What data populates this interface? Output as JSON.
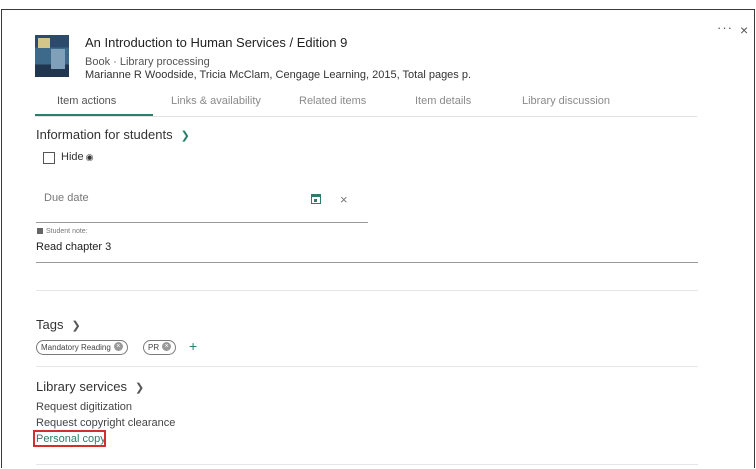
{
  "window": {
    "more_label": "···",
    "close_label": "×"
  },
  "item": {
    "title": "An Introduction to Human Services / Edition 9",
    "meta_line": "Book · Library processing",
    "authors_line": "Marianne R Woodside, Tricia McClam, Cengage Learning, 2015, Total pages p."
  },
  "tabs": [
    {
      "label": "Item actions",
      "active": true
    },
    {
      "label": "Links & availability",
      "active": false
    },
    {
      "label": "Related items",
      "active": false
    },
    {
      "label": "Item details",
      "active": false
    },
    {
      "label": "Library discussion",
      "active": false
    }
  ],
  "students": {
    "heading": "Information for students",
    "hide_label": "Hide",
    "hide_checked": false,
    "due_date_placeholder": "Due date",
    "clear_label": "×",
    "note_label": "Student note:",
    "note_value": "Read chapter 3"
  },
  "tags": {
    "heading": "Tags",
    "items": [
      {
        "label": "Mandatory Reading"
      },
      {
        "label": "PR"
      }
    ],
    "add_label": "+"
  },
  "library_services": {
    "heading": "Library services",
    "items": [
      {
        "label": "Request digitization"
      },
      {
        "label": "Request copyright clearance"
      },
      {
        "label": "Personal copy"
      }
    ]
  },
  "colors": {
    "accent": "#2e7d6b",
    "highlight": "#d32f2f"
  },
  "icons": {
    "hide": "eye-icon",
    "due_date": "calendar-icon",
    "note": "note-icon",
    "chip_remove": "close-circle-icon",
    "section_toggle": "chevron-down-icon"
  }
}
